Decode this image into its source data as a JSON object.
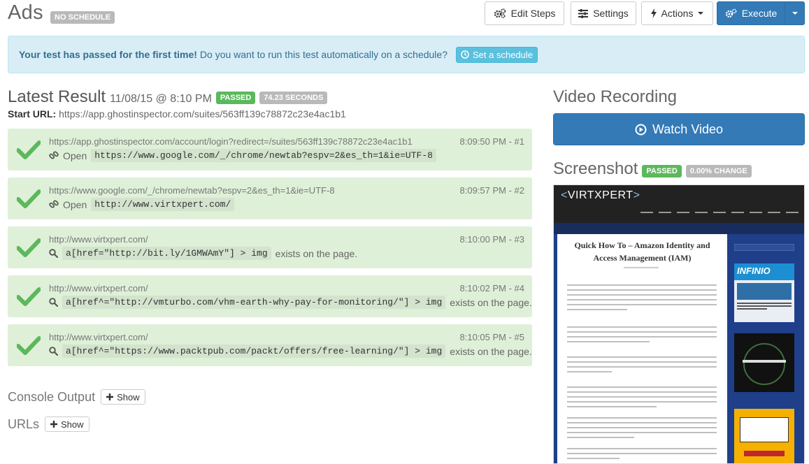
{
  "header": {
    "title": "Ads",
    "schedule_badge": "NO SCHEDULE",
    "edit_steps": "Edit Steps",
    "settings": "Settings",
    "actions": "Actions",
    "execute": "Execute"
  },
  "alert": {
    "strong": "Your test has passed for the first time!",
    "text": "Do you want to run this test automatically on a schedule?",
    "button": "Set a schedule"
  },
  "result": {
    "heading": "Latest Result",
    "date": "11/08/15 @ 8:10 PM",
    "status": "PASSED",
    "duration": "74.23 SECONDS",
    "start_url_label": "Start URL:",
    "start_url": "https://app.ghostinspector.com/suites/563ff139c78872c23e4ac1b1"
  },
  "steps": [
    {
      "url": "https://app.ghostinspector.com/account/login?redirect=/suites/563ff139c78872c23e4ac1b1",
      "time": "8:09:50 PM - #1",
      "icon": "link-icon",
      "prefix": "Open",
      "code": "https://www.google.com/_/chrome/newtab?espv=2&es_th=1&ie=UTF-8",
      "suffix": ""
    },
    {
      "url": "https://www.google.com/_/chrome/newtab?espv=2&es_th=1&ie=UTF-8",
      "time": "8:09:57 PM - #2",
      "icon": "link-icon",
      "prefix": "Open",
      "code": "http://www.virtxpert.com/",
      "suffix": ""
    },
    {
      "url": "http://www.virtxpert.com/",
      "time": "8:10:00 PM - #3",
      "icon": "search-icon",
      "prefix": "",
      "code": "a[href=\"http://bit.ly/1GMWAmY\"] > img",
      "suffix": "exists on the page."
    },
    {
      "url": "http://www.virtxpert.com/",
      "time": "8:10:02 PM - #4",
      "icon": "search-icon",
      "prefix": "",
      "code": "a[href^=\"http://vmturbo.com/vhm-earth-why-pay-for-monitoring/\"] > img",
      "suffix": "exists on the page."
    },
    {
      "url": "http://www.virtxpert.com/",
      "time": "8:10:05 PM - #5",
      "icon": "search-icon",
      "prefix": "",
      "code": "a[href^=\"https://www.packtpub.com/packt/offers/free-learning/\"] > img",
      "suffix": "exists on the page."
    }
  ],
  "console": {
    "title": "Console Output",
    "button": "Show"
  },
  "urls": {
    "title": "URLs",
    "button": "Show"
  },
  "video": {
    "heading": "Video Recording",
    "button": "Watch Video"
  },
  "screenshot": {
    "heading": "Screenshot",
    "status": "PASSED",
    "change": "0.00% CHANGE",
    "site_logo": "VIRTXPERT",
    "article_title": "Quick How To – Amazon Identity and Access Management (IAM)",
    "ad1_title": "INFINIO"
  },
  "colors": {
    "primary": "#337ab7",
    "success": "#5cb85c",
    "step_bg": "#dff0d8",
    "info_bg": "#d9edf7",
    "check": "#5cb85c"
  }
}
